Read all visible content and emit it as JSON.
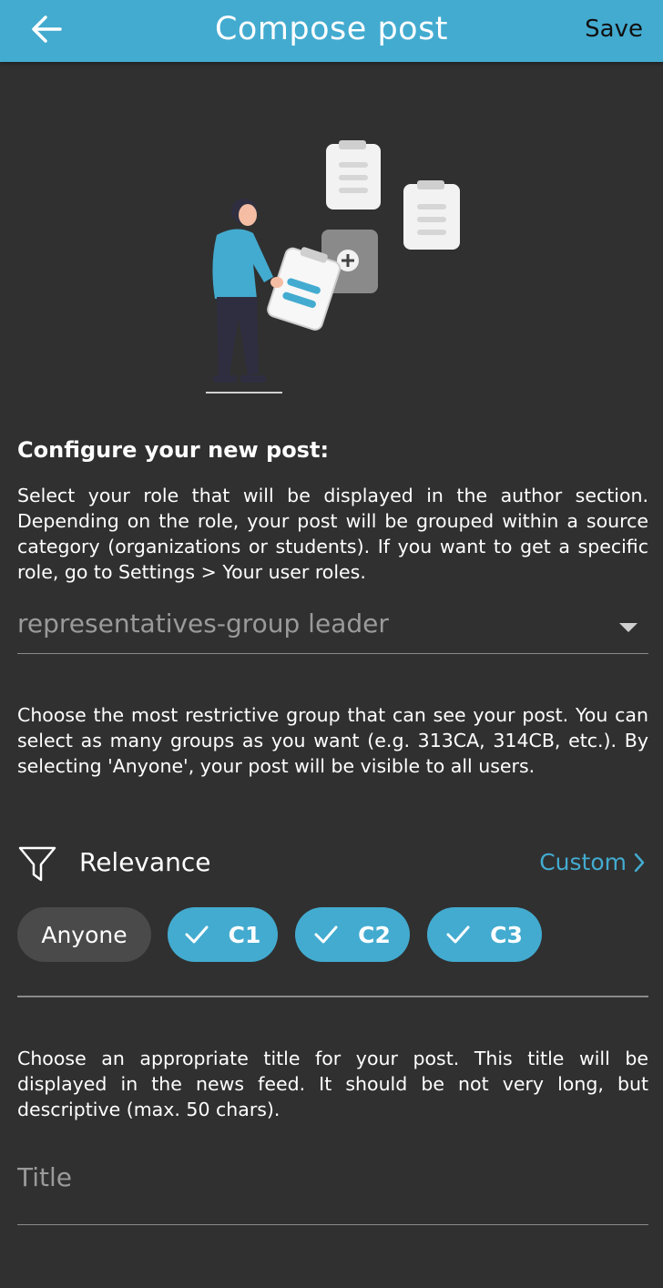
{
  "appbar": {
    "title": "Compose post",
    "save_label": "Save",
    "back_icon": "arrow-left-icon",
    "color": "#43abd0"
  },
  "role_section": {
    "heading": "Configure your new post:",
    "description": "Select your role that will be displayed in the author section. Depending on the role, your post will be grouped within a source category (organizations or students). If you want to get a specific role, go to Settings > Your user roles.",
    "selected_role": "representatives-group leader"
  },
  "visibility_section": {
    "description": "Choose the most restrictive group that can see your post. You can select as many groups as you want (e.g. 313CA, 314CB, etc.). By selecting 'Anyone', your post will be visible to all users.",
    "relevance_label": "Relevance",
    "custom_label": "Custom",
    "chips": [
      {
        "label": "Anyone",
        "selected": false
      },
      {
        "label": "C1",
        "selected": true
      },
      {
        "label": "C2",
        "selected": true
      },
      {
        "label": "C3",
        "selected": true
      }
    ]
  },
  "title_section": {
    "description": "Choose an appropriate title for your post. This title will be displayed in the news feed. It should be not very long, but descriptive (max. 50 chars).",
    "title_placeholder": "Title"
  },
  "colors": {
    "accent": "#43abd0",
    "background": "#303030",
    "chip_unselected": "#4a4a4a"
  }
}
